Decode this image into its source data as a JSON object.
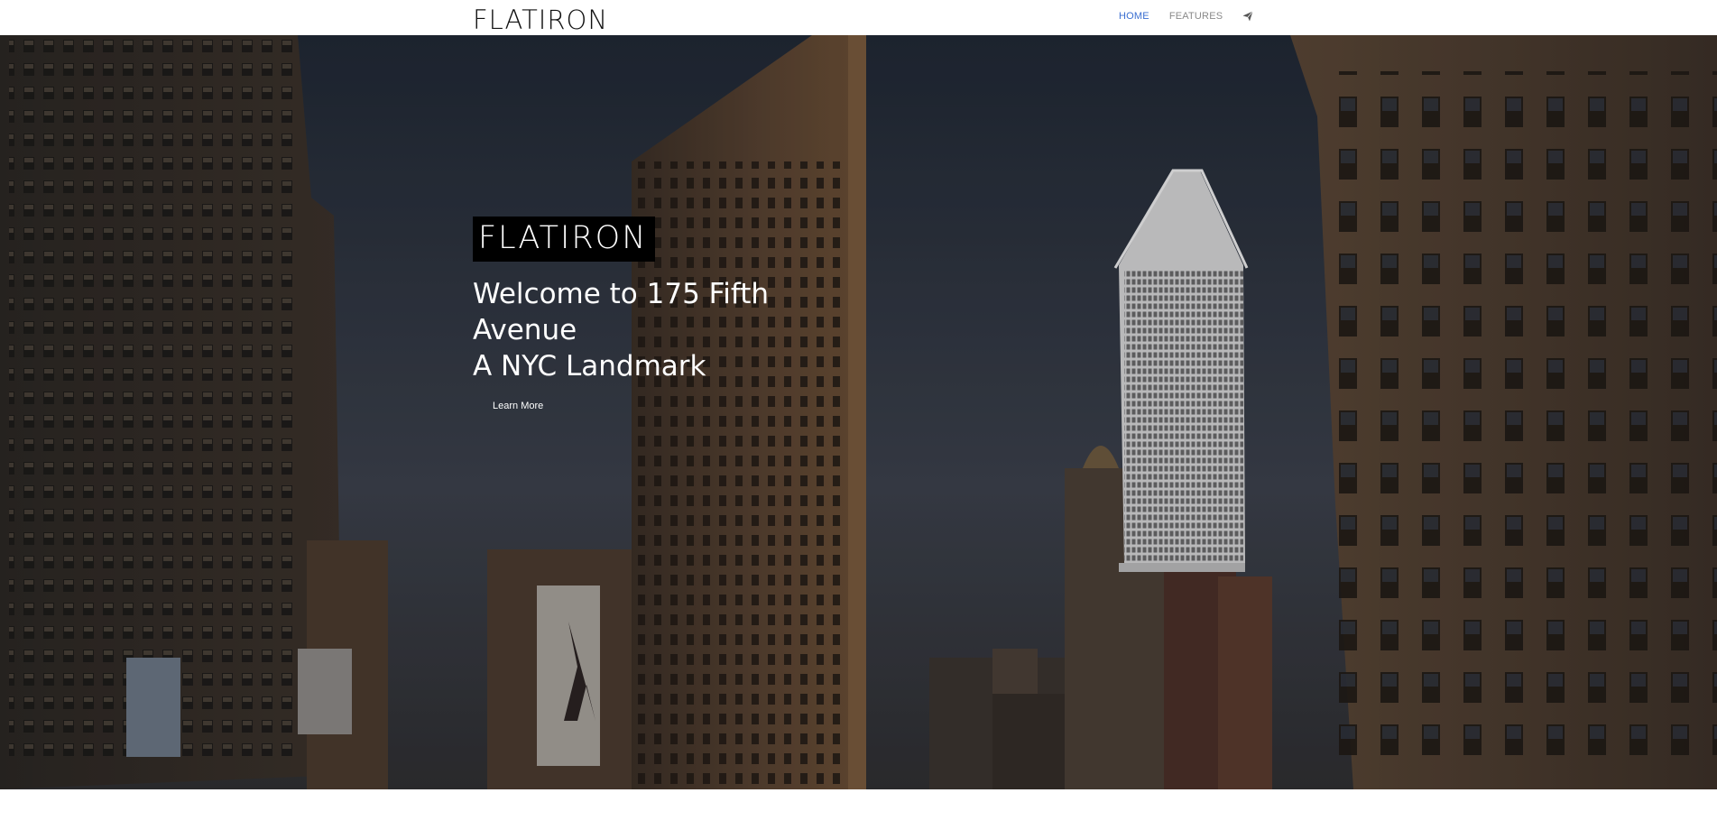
{
  "header": {
    "logo": "FLATIRON",
    "nav": {
      "home": "HOME",
      "features": "FEATURES"
    },
    "contact_icon": "paper-plane-icon"
  },
  "hero": {
    "badge": "FLATIRON",
    "title_line1": "Welcome to 175 Fifth",
    "title_line2": "Avenue",
    "title_line3": "A NYC Landmark",
    "cta": "Learn More"
  },
  "colors": {
    "nav_active": "#3b6fd1",
    "nav_inactive": "#8a8a8a",
    "hero_overlay": "#2b3340"
  }
}
